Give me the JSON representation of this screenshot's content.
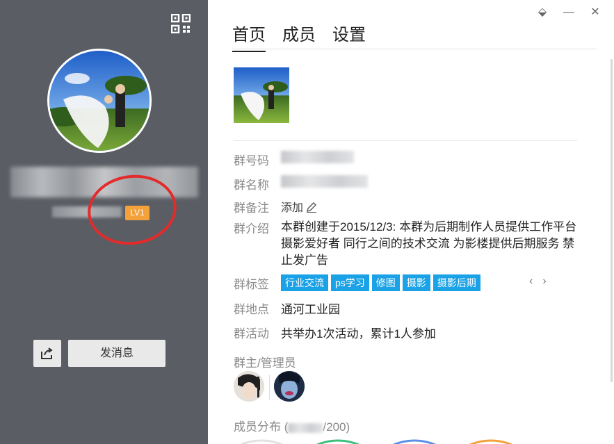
{
  "left_panel": {
    "level_badge": "LV1",
    "send_message_label": "发消息"
  },
  "window_controls": {
    "pin": "⬙",
    "minimize": "—",
    "close": "✕"
  },
  "tabs": [
    {
      "label": "首页",
      "active": true
    },
    {
      "label": "成员",
      "active": false
    },
    {
      "label": "设置",
      "active": false
    }
  ],
  "info": {
    "group_number_label": "群号码",
    "group_name_label": "群名称",
    "group_remark_label": "群备注",
    "group_remark_add": "添加",
    "group_intro_label": "群介绍",
    "group_intro_text": "本群创建于2015/12/3:  本群为后期制作人员提供工作平台 摄影爱好者  同行之间的技术交流  为影楼提供后期服务  禁止发广告",
    "group_tags_label": "群标签",
    "group_tags": [
      "行业交流",
      "ps学习",
      "修图",
      "摄影",
      "摄影后期"
    ],
    "group_location_label": "群地点",
    "group_location_value": "通河工业园",
    "group_activity_label": "群活动",
    "group_activity_value": "共举办1次活动，累计1人参加",
    "admins_label": "群主/管理员",
    "member_dist_label": "成员分布 (",
    "member_dist_suffix": "/200)"
  },
  "colors": {
    "left_bg": "#5a5d63",
    "tag_bg": "#1aa1e6",
    "level_badge": "#f2a13b",
    "annotation_circle": "#e32b2b"
  }
}
